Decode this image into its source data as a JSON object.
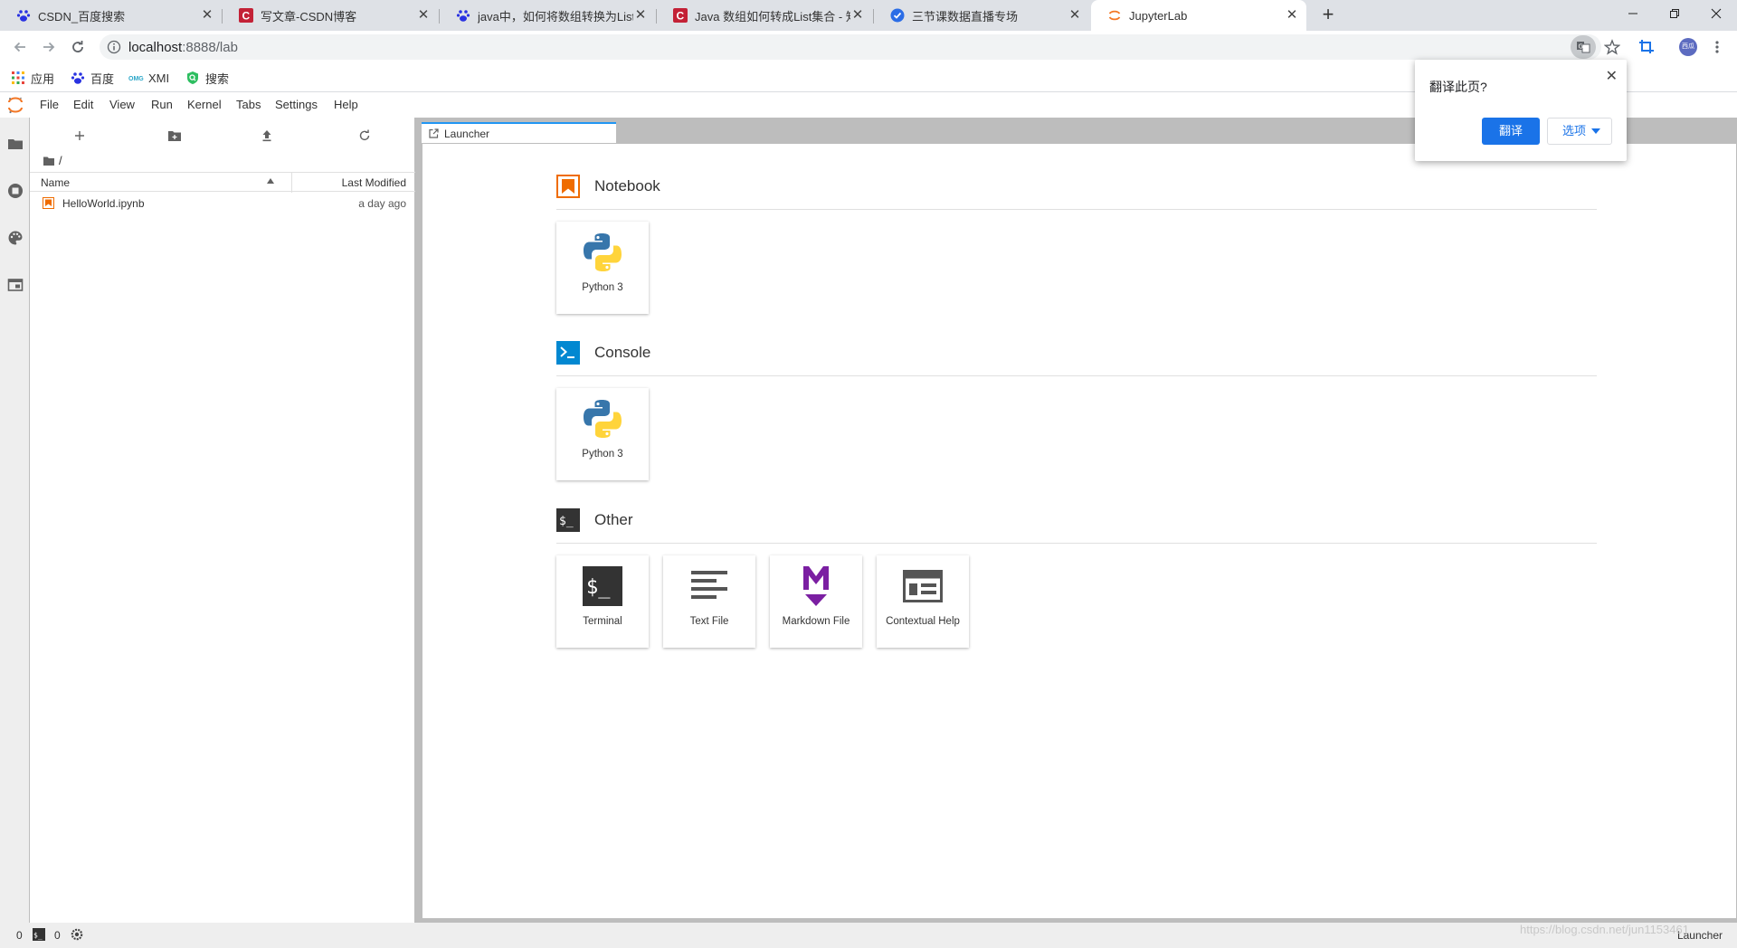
{
  "browser": {
    "tabs": [
      {
        "title": "CSDN_百度搜索",
        "favicon": "baidu-paw-icon"
      },
      {
        "title": "写文章-CSDN博客",
        "favicon": "csdn-icon"
      },
      {
        "title": "java中，如何将数组转换为List集",
        "favicon": "baidu-paw-icon"
      },
      {
        "title": "Java 数组如何转成List集合 - 知",
        "favicon": "csdn-icon"
      },
      {
        "title": "三节课数据直播专场",
        "favicon": "circle-check-icon"
      },
      {
        "title": "JupyterLab",
        "favicon": "jupyter-icon"
      }
    ],
    "active_tab": 5,
    "url_host": "localhost",
    "url_rest": ":8888/lab",
    "bookmarks": [
      {
        "label": "应用",
        "icon": "apps-grid-icon"
      },
      {
        "label": "百度",
        "icon": "baidu-paw-icon"
      },
      {
        "label": "XMI",
        "icon": "omg-icon"
      },
      {
        "label": "搜索",
        "icon": "search-shield-icon"
      }
    ],
    "profile_text": "西瓜"
  },
  "translate_popup": {
    "question": "翻译此页?",
    "translate_label": "翻译",
    "options_label": "选项"
  },
  "jupyter": {
    "menu": [
      "File",
      "Edit",
      "View",
      "Run",
      "Kernel",
      "Tabs",
      "Settings",
      "Help"
    ],
    "breadcrumb": "/",
    "columns": {
      "name": "Name",
      "modified": "Last Modified"
    },
    "files": [
      {
        "name": "HelloWorld.ipynb",
        "modified": "a day ago"
      }
    ],
    "main_tab": "Launcher",
    "sections": [
      {
        "title": "Notebook",
        "cards": [
          {
            "label": "Python 3",
            "icon": "python-icon"
          }
        ]
      },
      {
        "title": "Console",
        "cards": [
          {
            "label": "Python 3",
            "icon": "python-icon"
          }
        ]
      },
      {
        "title": "Other",
        "cards": [
          {
            "label": "Terminal",
            "icon": "terminal-icon"
          },
          {
            "label": "Text File",
            "icon": "text-file-icon"
          },
          {
            "label": "Markdown File",
            "icon": "markdown-icon"
          },
          {
            "label": "Contextual Help",
            "icon": "contextual-help-icon"
          }
        ]
      }
    ],
    "status": {
      "kernels": "0",
      "terminals": "0",
      "right": "Launcher"
    },
    "colors": {
      "accent": "#2196f3",
      "notebook": "#ef6c00",
      "console": "#0288d1",
      "markdown": "#7b1fa2"
    }
  },
  "watermark": "https://blog.csdn.net/jun1153461"
}
